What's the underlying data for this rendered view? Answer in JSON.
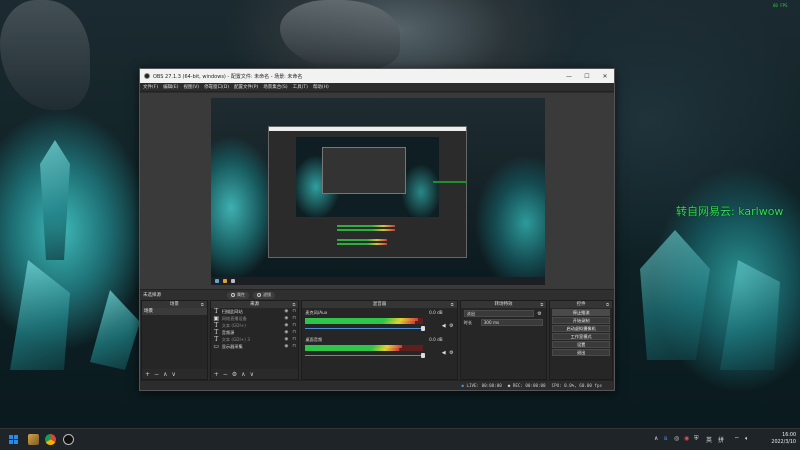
{
  "overlay": {
    "fps": "60 FPS",
    "channel_text": "转自网易云: karlwow"
  },
  "window": {
    "title": "OBS 27.1.3 (64-bit, windows) - 配置文件: 未命名 - 场景: 未命名",
    "minimize": "—",
    "maximize": "☐",
    "close": "✕"
  },
  "menu": [
    "文件(F)",
    "编辑(E)",
    "视图(V)",
    "停靠窗口(D)",
    "配置文件(P)",
    "场景集合(S)",
    "工具(T)",
    "帮助(H)"
  ],
  "scene_bar": {
    "current_scene": "未选择源",
    "properties": "属性",
    "filters": "滤镜"
  },
  "docks": {
    "scenes": {
      "title": "场景",
      "items": [
        "场景"
      ]
    },
    "sources": {
      "title": "来源",
      "items": [
        {
          "icon": "T",
          "label": "扫描此网站",
          "dim": false
        },
        {
          "icon": "▣",
          "label": "网络直播设备",
          "dim": true
        },
        {
          "icon": "T",
          "label": "文本 (GDI+)",
          "dim": true
        },
        {
          "icon": "T",
          "label": "音频源",
          "dim": false
        },
        {
          "icon": "T",
          "label": "文本 (GDI+) 3",
          "dim": true
        },
        {
          "icon": "▭",
          "label": "显示器采集",
          "dim": false
        }
      ]
    },
    "mixer": {
      "title": "混音器",
      "channels": [
        {
          "name": "麦克风/Aux",
          "db": "0.0 dB",
          "level": 0.96
        },
        {
          "name": "桌面音频",
          "db": "0.0 dB",
          "level": 0.82
        }
      ]
    },
    "transitions": {
      "title": "转场特效",
      "type": "淡出",
      "duration_label": "时长",
      "duration_value": "300 ms"
    },
    "controls": {
      "title": "控件",
      "buttons": [
        "停止推流",
        "开始录制",
        "启动虚拟摄像机",
        "工作室模式",
        "设置",
        "退出"
      ]
    },
    "footer_buttons": {
      "add": "+",
      "remove": "−",
      "up": "∧",
      "down": "∨",
      "gear": "⚙"
    }
  },
  "status": {
    "live": "LIVE: 00:00:00",
    "rec": "REC: 00:00:00",
    "cpu": "CPU: 0.0%, 60.00 fps"
  },
  "taskbar": {
    "time": "16:00",
    "date": "2022/3/10",
    "ime_lang": "英",
    "ime_mode": "拼"
  }
}
